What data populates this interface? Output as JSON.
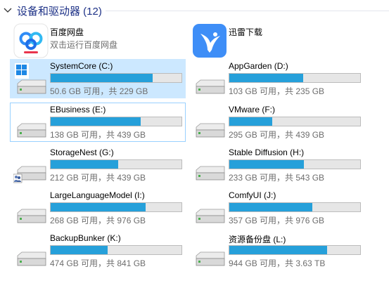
{
  "group": {
    "title": "设备和驱动器 (12)",
    "chevron_icon": "chevron-down-icon"
  },
  "apps": [
    {
      "name": "百度网盘",
      "subtitle": "双击运行百度网盘",
      "icon": "baidu-netdisk-icon"
    },
    {
      "name": "迅雷下载",
      "subtitle": "",
      "icon": "thunder-download-icon"
    }
  ],
  "drives": [
    {
      "name": "SystemCore (C:)",
      "space": "50.6 GB 可用，共 229 GB",
      "used_fraction": 0.779,
      "icon": "windows-drive-icon"
    },
    {
      "name": "AppGarden (D:)",
      "space": "103 GB 可用，共 235 GB",
      "used_fraction": 0.562,
      "icon": "hard-drive-icon"
    },
    {
      "name": "EBusiness (E:)",
      "space": "138 GB 可用，共 439 GB",
      "used_fraction": 0.686,
      "icon": "hard-drive-icon"
    },
    {
      "name": "VMware (F:)",
      "space": "295 GB 可用，共 439 GB",
      "used_fraction": 0.328,
      "icon": "hard-drive-icon"
    },
    {
      "name": "StorageNest (G:)",
      "space": "212 GB 可用，共 439 GB",
      "used_fraction": 0.517,
      "icon": "shared-drive-icon"
    },
    {
      "name": "Stable Diffusion (H:)",
      "space": "233 GB 可用，共 543 GB",
      "used_fraction": 0.571,
      "icon": "hard-drive-icon"
    },
    {
      "name": "LargeLanguageModel (I:)",
      "space": "268 GB 可用，共 976 GB",
      "used_fraction": 0.725,
      "icon": "hard-drive-icon"
    },
    {
      "name": "ComfyUI (J:)",
      "space": "357 GB 可用，共 976 GB",
      "used_fraction": 0.634,
      "icon": "hard-drive-icon"
    },
    {
      "name": "BackupBunker (K:)",
      "space": "474 GB 可用，共 841 GB",
      "used_fraction": 0.436,
      "icon": "hard-drive-icon"
    },
    {
      "name": "资源备份盘 (L:)",
      "space": "944 GB 可用，共 3.63 TB",
      "used_fraction": 0.746,
      "icon": "hard-drive-icon"
    }
  ],
  "colors": {
    "bar_fill": "#26a0da",
    "bar_track": "#e6e6e6",
    "header_text": "#1e3287",
    "selected_bg": "#cce8ff"
  }
}
